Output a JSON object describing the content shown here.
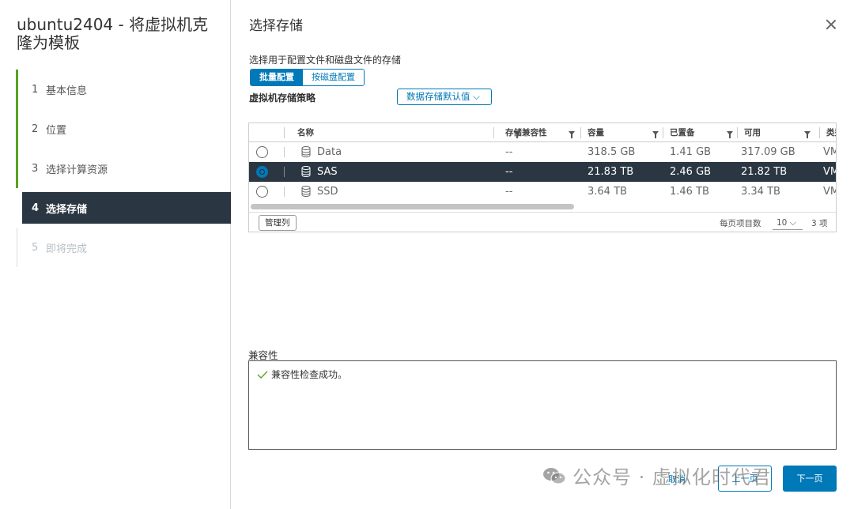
{
  "wizard": {
    "title": "ubuntu2404 - 将虚拟机克隆为模板",
    "steps": [
      {
        "num": "1",
        "label": "基本信息"
      },
      {
        "num": "2",
        "label": "位置"
      },
      {
        "num": "3",
        "label": "选择计算资源"
      },
      {
        "num": "4",
        "label": "选择存储"
      },
      {
        "num": "5",
        "label": "即将完成"
      }
    ]
  },
  "page": {
    "title": "选择存储",
    "subtitle": "选择用于配置文件和磁盘文件的存储",
    "toggle": {
      "batch": "批量配置",
      "per_disk": "按磁盘配置"
    },
    "policy_label": "虚拟机存储策略",
    "policy_value": "数据存储默认值 ⌵"
  },
  "grid": {
    "columns": [
      "名称",
      "存储兼容性",
      "容量",
      "已置备",
      "可用",
      "类型"
    ],
    "rows": [
      {
        "name": "Data",
        "compat": "--",
        "capacity": "318.5 GB",
        "provisioned": "1.41 GB",
        "free": "317.09 GB",
        "type": "VM"
      },
      {
        "name": "SAS",
        "compat": "--",
        "capacity": "21.83 TB",
        "provisioned": "2.46 GB",
        "free": "21.82 TB",
        "type": "VM"
      },
      {
        "name": "SSD",
        "compat": "--",
        "capacity": "3.64 TB",
        "provisioned": "1.46 TB",
        "free": "3.34 TB",
        "type": "VM"
      }
    ],
    "manage_columns": "管理列",
    "per_page_label": "每页项目数",
    "per_page_value": "10 ⌵",
    "count": "3 项"
  },
  "compat": {
    "label": "兼容性",
    "message": "兼容性检查成功。"
  },
  "buttons": {
    "cancel": "取消",
    "back": "上一页",
    "next": "下一页"
  },
  "watermark": "公众号 · 虚拟化时代君",
  "colors": {
    "accent": "#0079b8",
    "selected_row": "#2a3742",
    "done_step": "#5aa220"
  }
}
